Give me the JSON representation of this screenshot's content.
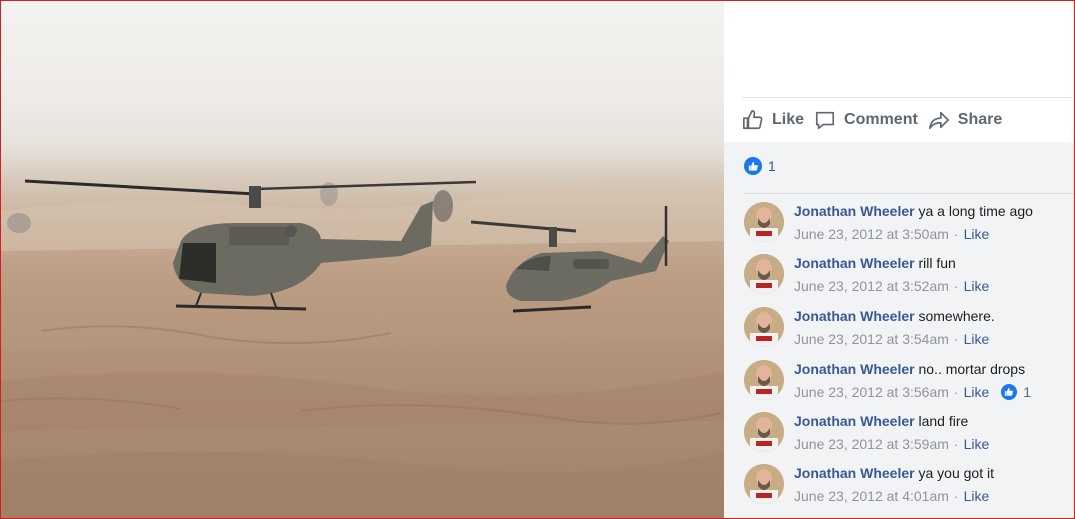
{
  "post_actions": {
    "like_label": "Like",
    "comment_label": "Comment",
    "share_label": "Share"
  },
  "reactions": {
    "count": "1"
  },
  "comments": [
    {
      "author": "Jonathan Wheeler",
      "text": "ya a long time ago",
      "time": "June 23, 2012 at 3:50am",
      "like_label": "Like",
      "likes": ""
    },
    {
      "author": "Jonathan Wheeler",
      "text": "rill fun",
      "time": "June 23, 2012 at 3:52am",
      "like_label": "Like",
      "likes": ""
    },
    {
      "author": "Jonathan Wheeler",
      "text": "somewhere.",
      "time": "June 23, 2012 at 3:54am",
      "like_label": "Like",
      "likes": ""
    },
    {
      "author": "Jonathan Wheeler",
      "text": "no.. mortar drops",
      "time": "June 23, 2012 at 3:56am",
      "like_label": "Like",
      "likes": "1"
    },
    {
      "author": "Jonathan Wheeler",
      "text": "land fire",
      "time": "June 23, 2012 at 3:59am",
      "like_label": "Like",
      "likes": ""
    },
    {
      "author": "Jonathan Wheeler",
      "text": "ya you got it",
      "time": "June 23, 2012 at 4:01am",
      "like_label": "Like",
      "likes": ""
    }
  ],
  "colors": {
    "link": "#385898",
    "like_blue": "#1877f2",
    "muted": "#90949c",
    "panel_bg": "#f2f3f5",
    "frame_border": "#d21f1f"
  },
  "icons": [
    "thumbs-up-icon",
    "comment-bubble-icon",
    "share-arrow-icon",
    "like-reaction-icon",
    "avatar"
  ]
}
